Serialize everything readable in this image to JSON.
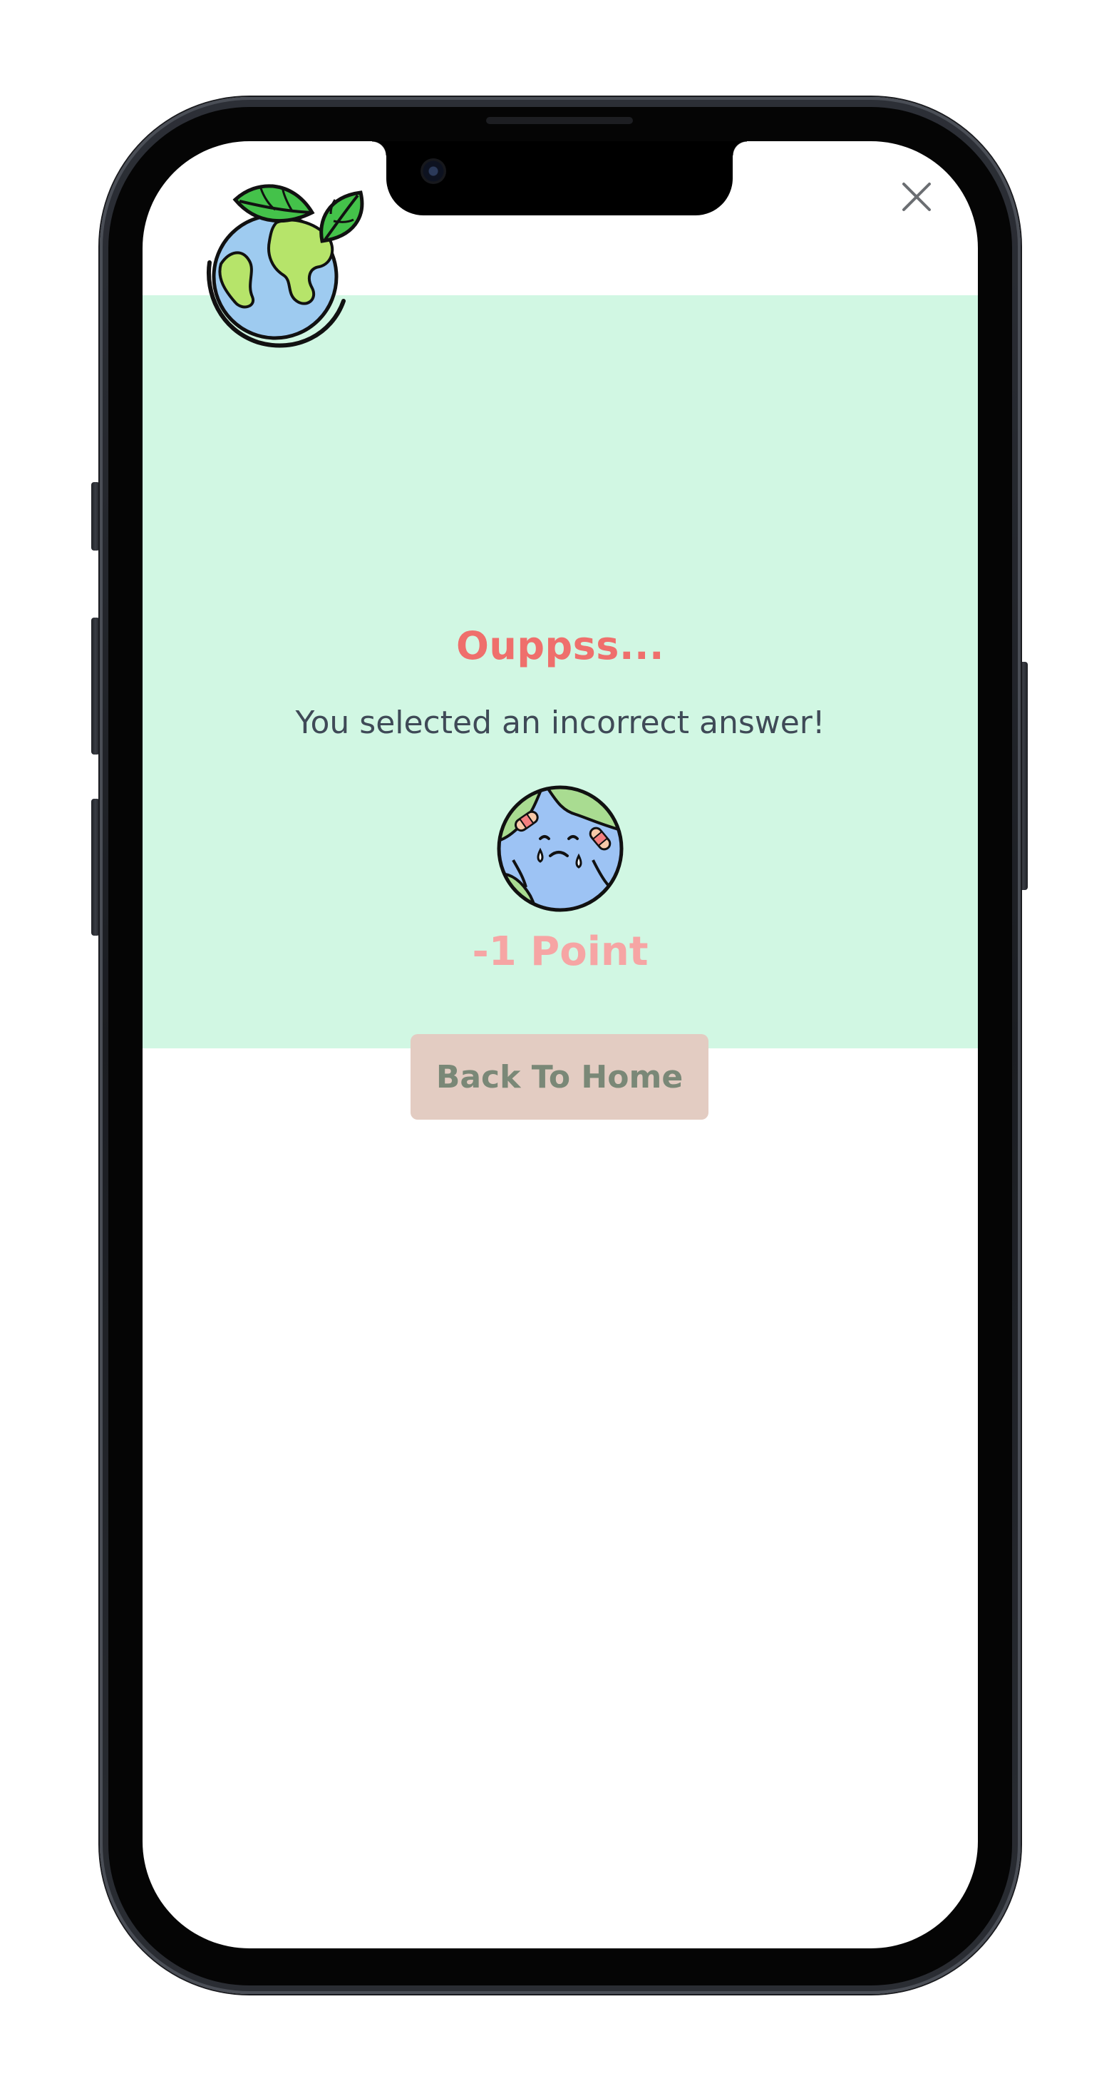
{
  "quiz_result": {
    "title": "Ouppss...",
    "message": "You selected an incorrect answer!",
    "points": "-1 Point",
    "home_button_label": "Back To Home"
  },
  "icons": {
    "logo": "earth-with-leaves-icon",
    "close": "close-icon",
    "result": "sad-earth-icon"
  },
  "colors": {
    "modal_background": "#d1f7e3",
    "title": "#ef6f6c",
    "message": "#3f4a57",
    "points": "#f6a5a4",
    "button_background": "#e3ccc2",
    "button_text": "#7a8877"
  }
}
